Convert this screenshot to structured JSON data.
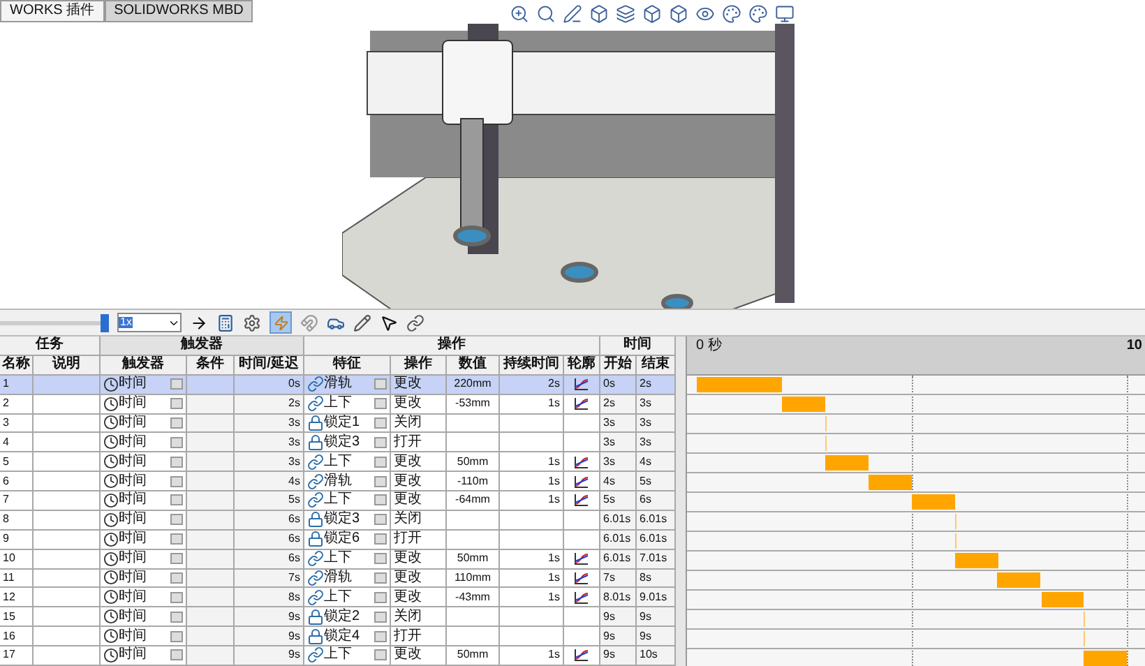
{
  "tabs": [
    {
      "label": "WORKS 插件",
      "selected": false
    },
    {
      "label": "SOLIDWORKS MBD",
      "selected": true
    }
  ],
  "toolbar": {
    "playback_slider": {
      "level": 1
    },
    "playback_speed": "1x"
  },
  "table": {
    "groups": [
      "任务",
      "触发器",
      "操作",
      "时间"
    ],
    "columns": [
      "名称",
      "说明",
      "触发器",
      "条件",
      "时间/延迟",
      "特征",
      "操作",
      "数值",
      "持续时间",
      "轮廓",
      "开始",
      "结束"
    ],
    "rows": [
      {
        "name": "1",
        "trigger": "时间",
        "delay": "0s",
        "feature": {
          "kind": "motor",
          "label": "滑轨"
        },
        "action": "更改",
        "value": "220mm",
        "duration": "2s",
        "start": "0s",
        "end": "2s",
        "selected": true
      },
      {
        "name": "2",
        "trigger": "时间",
        "delay": "2s",
        "feature": {
          "kind": "motor",
          "label": "上下"
        },
        "action": "更改",
        "value": "-53mm",
        "duration": "1s",
        "start": "2s",
        "end": "3s",
        "selected": false
      },
      {
        "name": "3",
        "trigger": "时间",
        "delay": "3s",
        "feature": {
          "kind": "lock",
          "label": "锁定1"
        },
        "action": "关闭",
        "start": "3s",
        "end": "3s",
        "selected": false
      },
      {
        "name": "4",
        "trigger": "时间",
        "delay": "3s",
        "feature": {
          "kind": "lock",
          "label": "锁定3"
        },
        "action": "打开",
        "start": "3s",
        "end": "3s",
        "selected": false
      },
      {
        "name": "5",
        "trigger": "时间",
        "delay": "3s",
        "feature": {
          "kind": "motor",
          "label": "上下"
        },
        "action": "更改",
        "value": "50mm",
        "duration": "1s",
        "start": "3s",
        "end": "4s",
        "selected": false
      },
      {
        "name": "6",
        "trigger": "时间",
        "delay": "4s",
        "feature": {
          "kind": "motor",
          "label": "滑轨"
        },
        "action": "更改",
        "value": "-110m",
        "duration": "1s",
        "start": "4s",
        "end": "5s",
        "selected": false
      },
      {
        "name": "7",
        "trigger": "时间",
        "delay": "5s",
        "feature": {
          "kind": "motor",
          "label": "上下"
        },
        "action": "更改",
        "value": "-64mm",
        "duration": "1s",
        "start": "5s",
        "end": "6s",
        "selected": false
      },
      {
        "name": "8",
        "trigger": "时间",
        "delay": "6s",
        "feature": {
          "kind": "lock",
          "label": "锁定3"
        },
        "action": "关闭",
        "start": "6.01s",
        "end": "6.01s",
        "selected": false
      },
      {
        "name": "9",
        "trigger": "时间",
        "delay": "6s",
        "feature": {
          "kind": "lock",
          "label": "锁定6"
        },
        "action": "打开",
        "start": "6.01s",
        "end": "6.01s",
        "selected": false
      },
      {
        "name": "10",
        "trigger": "时间",
        "delay": "6s",
        "feature": {
          "kind": "motor",
          "label": "上下"
        },
        "action": "更改",
        "value": "50mm",
        "duration": "1s",
        "start": "6.01s",
        "end": "7.01s",
        "selected": false
      },
      {
        "name": "11",
        "trigger": "时间",
        "delay": "7s",
        "feature": {
          "kind": "motor",
          "label": "滑轨"
        },
        "action": "更改",
        "value": "110mm",
        "duration": "1s",
        "start": "7s",
        "end": "8s",
        "selected": false
      },
      {
        "name": "12",
        "trigger": "时间",
        "delay": "8s",
        "feature": {
          "kind": "motor",
          "label": "上下"
        },
        "action": "更改",
        "value": "-43mm",
        "duration": "1s",
        "start": "8.01s",
        "end": "9.01s",
        "selected": false
      },
      {
        "name": "15",
        "trigger": "时间",
        "delay": "9s",
        "feature": {
          "kind": "lock",
          "label": "锁定2"
        },
        "action": "关闭",
        "start": "9s",
        "end": "9s",
        "selected": false
      },
      {
        "name": "16",
        "trigger": "时间",
        "delay": "9s",
        "feature": {
          "kind": "lock",
          "label": "锁定4"
        },
        "action": "打开",
        "start": "9s",
        "end": "9s",
        "selected": false
      },
      {
        "name": "17",
        "trigger": "时间",
        "delay": "9s",
        "feature": {
          "kind": "motor",
          "label": "上下"
        },
        "action": "更改",
        "value": "50mm",
        "duration": "1s",
        "start": "9s",
        "end": "10s",
        "selected": false
      }
    ]
  },
  "timeline": {
    "start_label": "0 秒",
    "end_label": "10"
  }
}
